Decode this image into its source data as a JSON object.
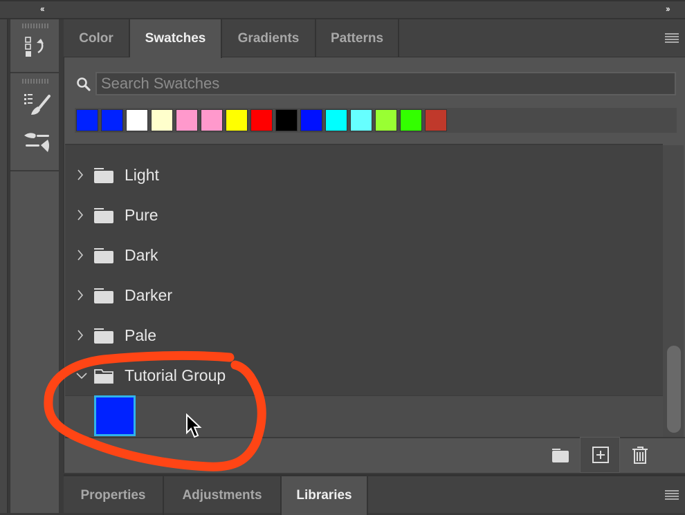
{
  "topbar": {
    "collapse_left_label": "‹‹",
    "expand_right_label": "››"
  },
  "dock": {
    "items": [
      {
        "name": "history-panel",
        "icon": "history-icon"
      },
      {
        "name": "brush-settings-panel",
        "icon": "brush-icon"
      },
      {
        "name": "brush-presets-panel",
        "icon": "brush-sliders-icon"
      }
    ]
  },
  "tabs": [
    {
      "label": "Color",
      "active": false
    },
    {
      "label": "Swatches",
      "active": true
    },
    {
      "label": "Gradients",
      "active": false
    },
    {
      "label": "Patterns",
      "active": false
    }
  ],
  "search": {
    "placeholder": "Search Swatches",
    "value": ""
  },
  "recent_swatches": [
    "#0022ff",
    "#0022ff",
    "#ffffff",
    "#ffffcc",
    "#ff99cc",
    "#ff99cc",
    "#ffff00",
    "#ff0000",
    "#000000",
    "#0011ff",
    "#00ffff",
    "#66ffff",
    "#99ff33",
    "#33ff00",
    "#c0392b"
  ],
  "groups": [
    {
      "label": "Light",
      "expanded": false
    },
    {
      "label": "Pure",
      "expanded": false
    },
    {
      "label": "Dark",
      "expanded": false
    },
    {
      "label": "Darker",
      "expanded": false
    },
    {
      "label": "Pale",
      "expanded": false
    },
    {
      "label": "Tutorial Group",
      "expanded": true,
      "swatches": [
        "#0022ff"
      ]
    }
  ],
  "scrollbar": {
    "position": 0.95
  },
  "footer": {
    "new_group_icon": "folder-icon",
    "new_swatch_icon": "plus-square-icon",
    "delete_icon": "trash-icon"
  },
  "bottom_tabs": [
    {
      "label": "Properties",
      "active": false
    },
    {
      "label": "Adjustments",
      "active": false
    },
    {
      "label": "Libraries",
      "active": true
    }
  ],
  "annotation": {
    "color": "#ff4515",
    "shape": "hand-drawn circle around Tutorial Group"
  }
}
